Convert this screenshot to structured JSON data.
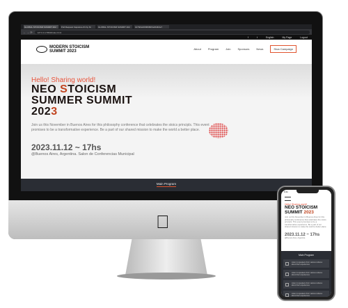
{
  "browser": {
    "tabs": [
      "GLOBAL STOICISM SUMMIT 202",
      "Pull Request Capstone #1 by Ni",
      "GLOBAL STOICISM SUMMIT 202",
      "3c7bbfebfb86980f3e6b0b0e7"
    ],
    "url": "127.0.0.1:5500/index.html"
  },
  "topbar": {
    "facebook": "f",
    "twitter": "t",
    "language": "English",
    "mypage": "My Page",
    "logout": "Logout"
  },
  "logo": {
    "line1": "MODERN STOICISM",
    "line2": "SUMMIT 2023"
  },
  "nav": [
    "About",
    "Program",
    "Join",
    "Sponsors",
    "News"
  ],
  "cta": "Stoa Campaign",
  "hero": {
    "hello": "Hello! Sharing world!",
    "title1": "NEO ",
    "title1b": "S",
    "title1c": "TOICISM",
    "title2": "SUMMER SUMMIT",
    "title3a": "202",
    "title3b": "3",
    "desc": "Join us this November in Buenos Aires for this philosophy conference that celebrates the stoics principls. This event promises to be a transformative experience. Be a part of our shared mission to make the world a better place.",
    "date": "2023.11.12 ~ 17hs",
    "place": "@Buenos Aires, Argentina. Salon de Conferencias Municipal"
  },
  "main_program": "Main Program",
  "mobile": {
    "time": "9:41",
    "title1": "NEO STOICISM",
    "title2a": "SUMMIT ",
    "title2b": "2023",
    "place": "@Buenos Aires, Argentina",
    "item_text": "Listen to speakers from various cultures about their experiences"
  }
}
